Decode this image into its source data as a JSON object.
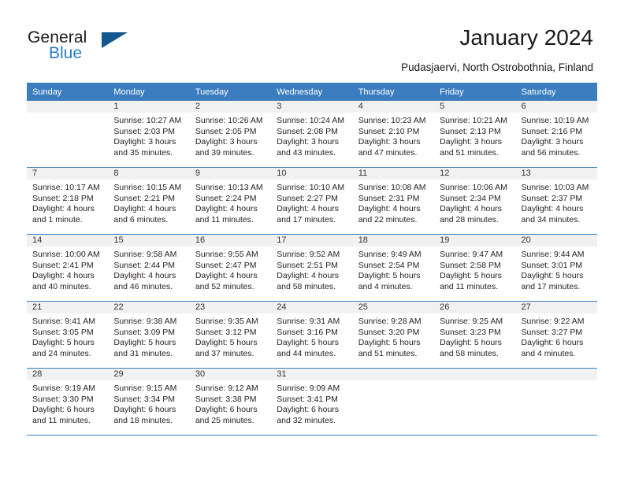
{
  "brand": {
    "name_part1": "General",
    "name_part2": "Blue",
    "flag_icon": "blue-triangle-flag-icon",
    "accent_color": "#2b7cc4",
    "flag_color": "#15588f"
  },
  "header": {
    "title": "January 2024",
    "subtitle": "Pudasjaervi, North Ostrobothnia, Finland"
  },
  "calendar": {
    "header_bg": "#3b7dbf",
    "daynum_bg": "#f1f1f1",
    "weekdays": [
      "Sunday",
      "Monday",
      "Tuesday",
      "Wednesday",
      "Thursday",
      "Friday",
      "Saturday"
    ],
    "weeks": [
      [
        {
          "day": "",
          "lines": []
        },
        {
          "day": "1",
          "lines": [
            "Sunrise: 10:27 AM",
            "Sunset: 2:03 PM",
            "Daylight: 3 hours",
            "and 35 minutes."
          ]
        },
        {
          "day": "2",
          "lines": [
            "Sunrise: 10:26 AM",
            "Sunset: 2:05 PM",
            "Daylight: 3 hours",
            "and 39 minutes."
          ]
        },
        {
          "day": "3",
          "lines": [
            "Sunrise: 10:24 AM",
            "Sunset: 2:08 PM",
            "Daylight: 3 hours",
            "and 43 minutes."
          ]
        },
        {
          "day": "4",
          "lines": [
            "Sunrise: 10:23 AM",
            "Sunset: 2:10 PM",
            "Daylight: 3 hours",
            "and 47 minutes."
          ]
        },
        {
          "day": "5",
          "lines": [
            "Sunrise: 10:21 AM",
            "Sunset: 2:13 PM",
            "Daylight: 3 hours",
            "and 51 minutes."
          ]
        },
        {
          "day": "6",
          "lines": [
            "Sunrise: 10:19 AM",
            "Sunset: 2:16 PM",
            "Daylight: 3 hours",
            "and 56 minutes."
          ]
        }
      ],
      [
        {
          "day": "7",
          "lines": [
            "Sunrise: 10:17 AM",
            "Sunset: 2:18 PM",
            "Daylight: 4 hours",
            "and 1 minute."
          ]
        },
        {
          "day": "8",
          "lines": [
            "Sunrise: 10:15 AM",
            "Sunset: 2:21 PM",
            "Daylight: 4 hours",
            "and 6 minutes."
          ]
        },
        {
          "day": "9",
          "lines": [
            "Sunrise: 10:13 AM",
            "Sunset: 2:24 PM",
            "Daylight: 4 hours",
            "and 11 minutes."
          ]
        },
        {
          "day": "10",
          "lines": [
            "Sunrise: 10:10 AM",
            "Sunset: 2:27 PM",
            "Daylight: 4 hours",
            "and 17 minutes."
          ]
        },
        {
          "day": "11",
          "lines": [
            "Sunrise: 10:08 AM",
            "Sunset: 2:31 PM",
            "Daylight: 4 hours",
            "and 22 minutes."
          ]
        },
        {
          "day": "12",
          "lines": [
            "Sunrise: 10:06 AM",
            "Sunset: 2:34 PM",
            "Daylight: 4 hours",
            "and 28 minutes."
          ]
        },
        {
          "day": "13",
          "lines": [
            "Sunrise: 10:03 AM",
            "Sunset: 2:37 PM",
            "Daylight: 4 hours",
            "and 34 minutes."
          ]
        }
      ],
      [
        {
          "day": "14",
          "lines": [
            "Sunrise: 10:00 AM",
            "Sunset: 2:41 PM",
            "Daylight: 4 hours",
            "and 40 minutes."
          ]
        },
        {
          "day": "15",
          "lines": [
            "Sunrise: 9:58 AM",
            "Sunset: 2:44 PM",
            "Daylight: 4 hours",
            "and 46 minutes."
          ]
        },
        {
          "day": "16",
          "lines": [
            "Sunrise: 9:55 AM",
            "Sunset: 2:47 PM",
            "Daylight: 4 hours",
            "and 52 minutes."
          ]
        },
        {
          "day": "17",
          "lines": [
            "Sunrise: 9:52 AM",
            "Sunset: 2:51 PM",
            "Daylight: 4 hours",
            "and 58 minutes."
          ]
        },
        {
          "day": "18",
          "lines": [
            "Sunrise: 9:49 AM",
            "Sunset: 2:54 PM",
            "Daylight: 5 hours",
            "and 4 minutes."
          ]
        },
        {
          "day": "19",
          "lines": [
            "Sunrise: 9:47 AM",
            "Sunset: 2:58 PM",
            "Daylight: 5 hours",
            "and 11 minutes."
          ]
        },
        {
          "day": "20",
          "lines": [
            "Sunrise: 9:44 AM",
            "Sunset: 3:01 PM",
            "Daylight: 5 hours",
            "and 17 minutes."
          ]
        }
      ],
      [
        {
          "day": "21",
          "lines": [
            "Sunrise: 9:41 AM",
            "Sunset: 3:05 PM",
            "Daylight: 5 hours",
            "and 24 minutes."
          ]
        },
        {
          "day": "22",
          "lines": [
            "Sunrise: 9:38 AM",
            "Sunset: 3:09 PM",
            "Daylight: 5 hours",
            "and 31 minutes."
          ]
        },
        {
          "day": "23",
          "lines": [
            "Sunrise: 9:35 AM",
            "Sunset: 3:12 PM",
            "Daylight: 5 hours",
            "and 37 minutes."
          ]
        },
        {
          "day": "24",
          "lines": [
            "Sunrise: 9:31 AM",
            "Sunset: 3:16 PM",
            "Daylight: 5 hours",
            "and 44 minutes."
          ]
        },
        {
          "day": "25",
          "lines": [
            "Sunrise: 9:28 AM",
            "Sunset: 3:20 PM",
            "Daylight: 5 hours",
            "and 51 minutes."
          ]
        },
        {
          "day": "26",
          "lines": [
            "Sunrise: 9:25 AM",
            "Sunset: 3:23 PM",
            "Daylight: 5 hours",
            "and 58 minutes."
          ]
        },
        {
          "day": "27",
          "lines": [
            "Sunrise: 9:22 AM",
            "Sunset: 3:27 PM",
            "Daylight: 6 hours",
            "and 4 minutes."
          ]
        }
      ],
      [
        {
          "day": "28",
          "lines": [
            "Sunrise: 9:19 AM",
            "Sunset: 3:30 PM",
            "Daylight: 6 hours",
            "and 11 minutes."
          ]
        },
        {
          "day": "29",
          "lines": [
            "Sunrise: 9:15 AM",
            "Sunset: 3:34 PM",
            "Daylight: 6 hours",
            "and 18 minutes."
          ]
        },
        {
          "day": "30",
          "lines": [
            "Sunrise: 9:12 AM",
            "Sunset: 3:38 PM",
            "Daylight: 6 hours",
            "and 25 minutes."
          ]
        },
        {
          "day": "31",
          "lines": [
            "Sunrise: 9:09 AM",
            "Sunset: 3:41 PM",
            "Daylight: 6 hours",
            "and 32 minutes."
          ]
        },
        {
          "day": "",
          "lines": []
        },
        {
          "day": "",
          "lines": []
        },
        {
          "day": "",
          "lines": []
        }
      ]
    ]
  }
}
